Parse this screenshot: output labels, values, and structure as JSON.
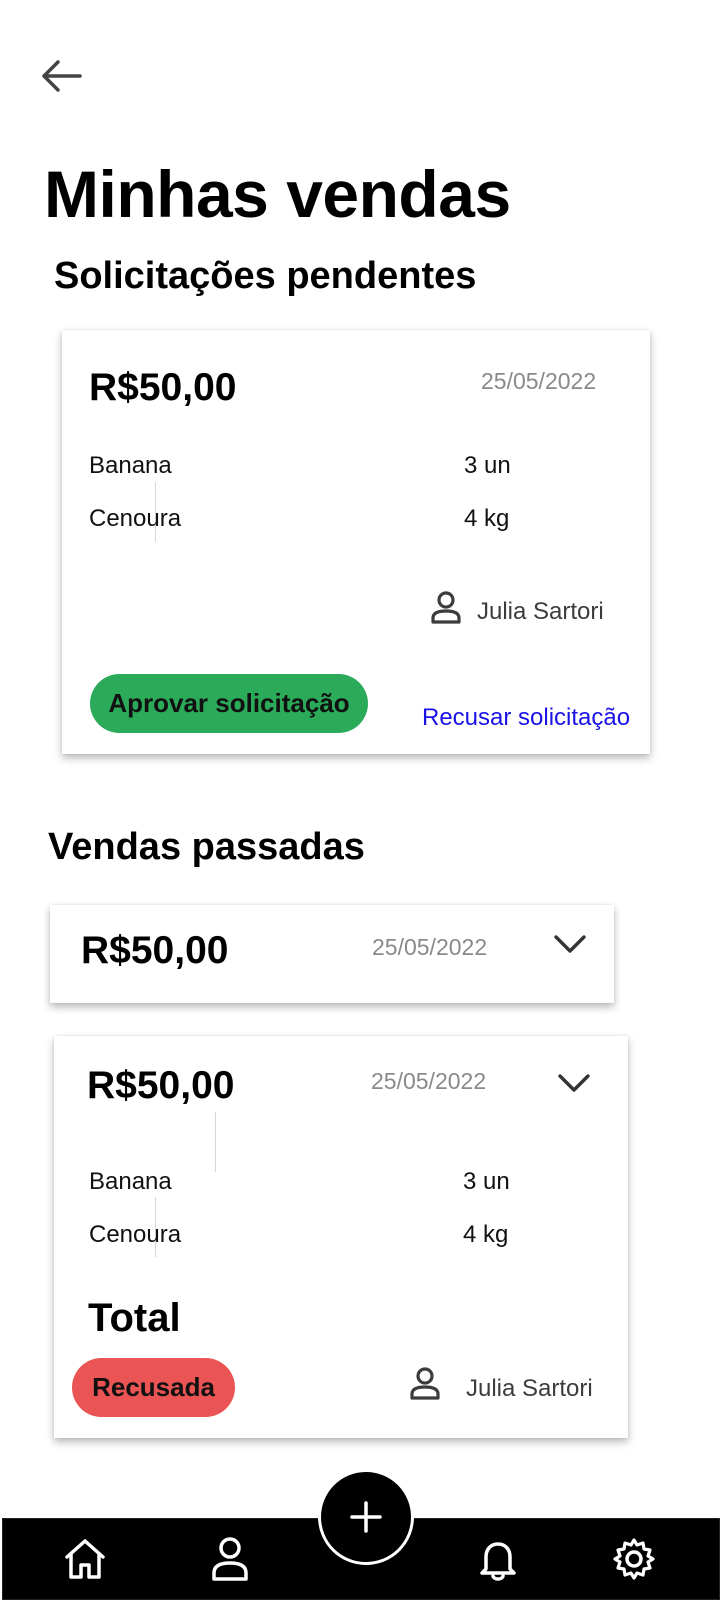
{
  "header": {
    "title": "Minhas vendas",
    "back_icon": "arrow-left-icon"
  },
  "pending": {
    "section_title": "Solicitações pendentes",
    "card": {
      "price": "R$50,00",
      "date": "25/05/2022",
      "items": [
        {
          "name": "Banana",
          "qty": "3  un"
        },
        {
          "name": "Cenoura",
          "qty": "4 kg"
        }
      ],
      "user": "Julia Sartori",
      "approve_label": "Aprovar solicitação",
      "reject_label": "Recusar solicitação"
    }
  },
  "past": {
    "section_title": "Vendas passadas",
    "collapsed_card": {
      "price": "R$50,00",
      "date": "25/05/2022"
    },
    "expanded_card": {
      "price": "R$50,00",
      "date": "25/05/2022",
      "items": [
        {
          "name": "Banana",
          "qty": "3  un"
        },
        {
          "name": "Cenoura",
          "qty": "4 kg"
        }
      ],
      "total_label": "Total",
      "status_label": "Recusada",
      "user": "Julia Sartori"
    }
  },
  "nav": {
    "items": [
      "home-icon",
      "user-icon",
      "add-icon",
      "bell-icon",
      "settings-icon"
    ]
  },
  "colors": {
    "approve": "#2bab59",
    "reject_link": "#1a12e6",
    "refused": "#eb5454",
    "navbar": "#000000"
  }
}
